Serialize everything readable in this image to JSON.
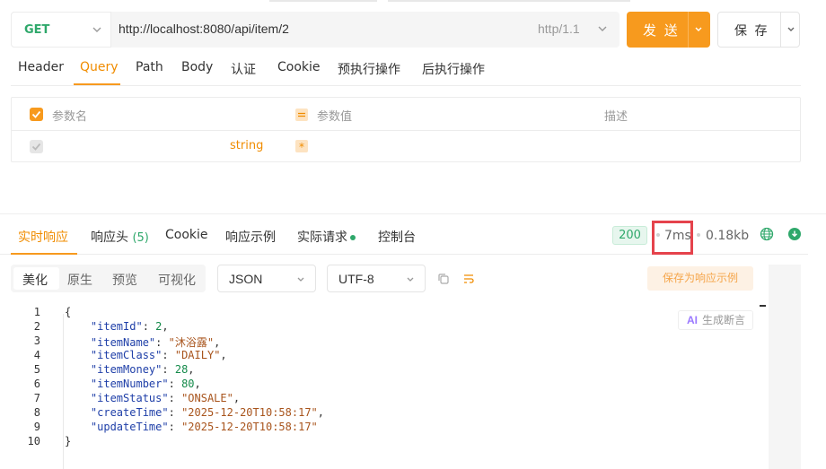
{
  "request": {
    "method": "GET",
    "url": "http://localhost:8080/api/item/2",
    "protocol": "http/1.1",
    "send_label": "发 送",
    "save_label": "保 存"
  },
  "request_tabs": [
    "Header",
    "Query",
    "Path",
    "Body",
    "认证",
    "Cookie",
    "预执行操作",
    "后执行操作"
  ],
  "active_request_tab": "Query",
  "params": {
    "headers": [
      "参数名",
      "参数值",
      "描述"
    ],
    "rows": [
      {
        "name": "",
        "type": "string",
        "required": "*",
        "value": "",
        "description": ""
      }
    ]
  },
  "response_tabs": {
    "realtime": "实时响应",
    "headers": "响应头",
    "headers_count": "(5)",
    "cookie": "Cookie",
    "example": "响应示例",
    "actual_request": "实际请求",
    "console": "控制台"
  },
  "response_meta": {
    "status": "200",
    "time": "7ms",
    "size": "0.18kb"
  },
  "view_modes": [
    "美化",
    "原生",
    "预览",
    "可视化"
  ],
  "active_view": "美化",
  "format": "JSON",
  "encoding": "UTF-8",
  "save_example_label": "保存为响应示例",
  "ai_label": "生成断言",
  "ai_badge": "AI",
  "code_lines": [
    "1",
    "2",
    "3",
    "4",
    "5",
    "6",
    "7",
    "8",
    "9",
    "10"
  ],
  "response_body": {
    "open": "{",
    "fields": [
      {
        "key": "\"itemId\"",
        "value": "2",
        "kind": "number",
        "comma": ","
      },
      {
        "key": "\"itemName\"",
        "value": "\"沐浴露\"",
        "kind": "string",
        "comma": ","
      },
      {
        "key": "\"itemClass\"",
        "value": "\"DAILY\"",
        "kind": "string",
        "comma": ","
      },
      {
        "key": "\"itemMoney\"",
        "value": "28",
        "kind": "number",
        "comma": ","
      },
      {
        "key": "\"itemNumber\"",
        "value": "80",
        "kind": "number",
        "comma": ","
      },
      {
        "key": "\"itemStatus\"",
        "value": "\"ONSALE\"",
        "kind": "string",
        "comma": ","
      },
      {
        "key": "\"createTime\"",
        "value": "\"2025-12-20T10:58:17\"",
        "kind": "string",
        "comma": ","
      },
      {
        "key": "\"updateTime\"",
        "value": "\"2025-12-20T10:58:17\"",
        "kind": "string",
        "comma": ""
      }
    ],
    "close": "}"
  },
  "colors": {
    "accent": "#f79a1e",
    "status_ok": "#2fa86b",
    "highlight_box": "#e5434c"
  },
  "icons": {
    "method_dropdown": "chevron-down-icon",
    "copy": "copy-icon",
    "wrap": "wrap-lines-icon",
    "globe": "globe-icon",
    "download": "download-icon"
  }
}
